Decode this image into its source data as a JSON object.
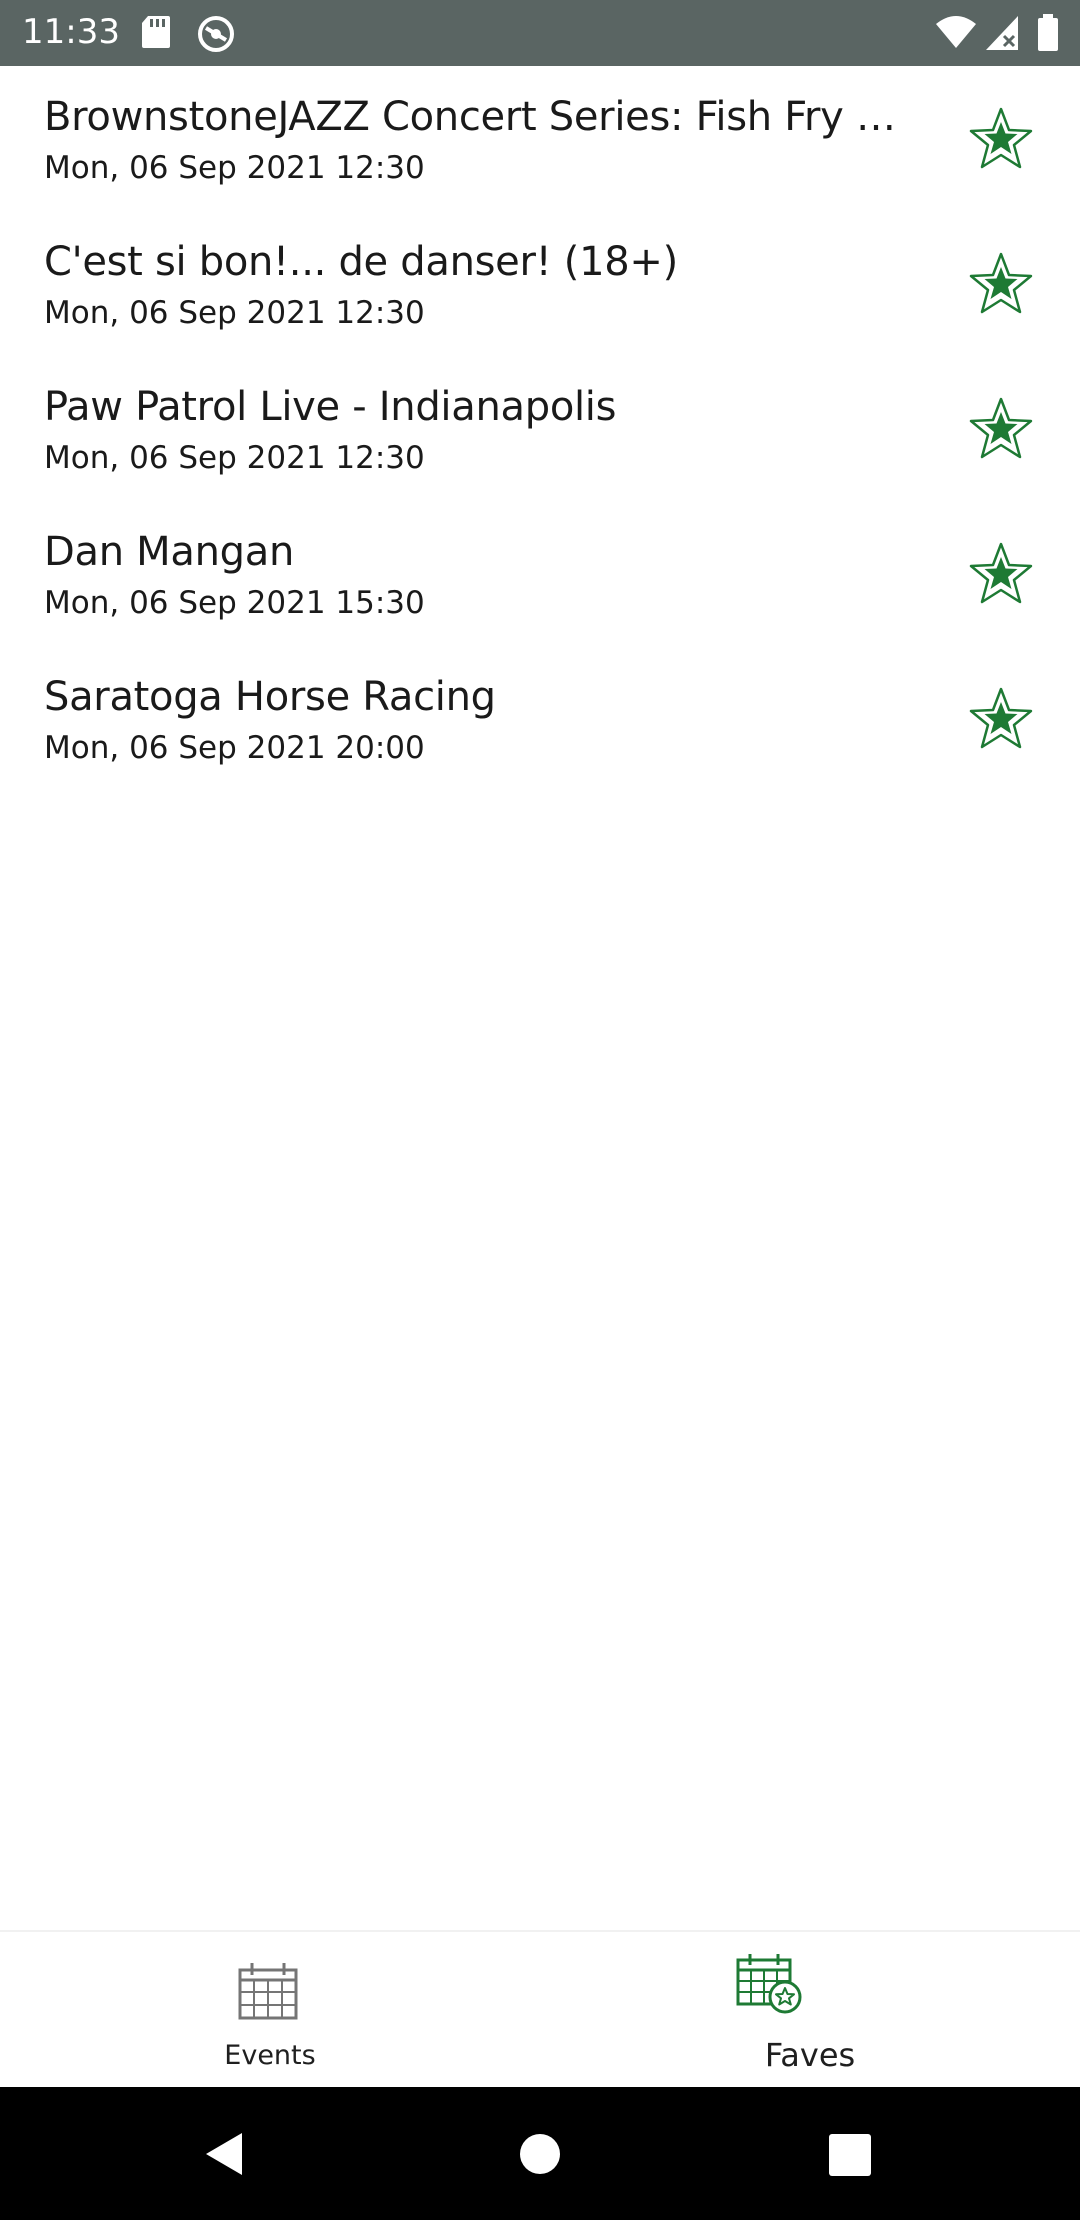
{
  "status_bar": {
    "time": "11:33",
    "icons": [
      "sd-card-icon",
      "sync-icon",
      "wifi-icon",
      "signal-icon",
      "battery-icon"
    ]
  },
  "events": [
    {
      "title": "BrownstoneJAZZ Concert Series: Fish Fry & O...",
      "date": "Mon, 06 Sep 2021 12:30",
      "favorited": true
    },
    {
      "title": "C'est si bon!... de danser! (18+)",
      "date": "Mon, 06 Sep 2021 12:30",
      "favorited": true
    },
    {
      "title": "Paw Patrol Live - Indianapolis",
      "date": "Mon, 06 Sep 2021 12:30",
      "favorited": true
    },
    {
      "title": "Dan Mangan",
      "date": "Mon, 06 Sep 2021 15:30",
      "favorited": true
    },
    {
      "title": "Saratoga Horse Racing",
      "date": "Mon, 06 Sep 2021 20:00",
      "favorited": true
    }
  ],
  "bottom_nav": {
    "events_label": "Events",
    "faves_label": "Faves",
    "selected": "Faves"
  },
  "colors": {
    "accent": "#1e7a34",
    "status_bar": "#5a6563",
    "icon_gray": "#757575"
  }
}
